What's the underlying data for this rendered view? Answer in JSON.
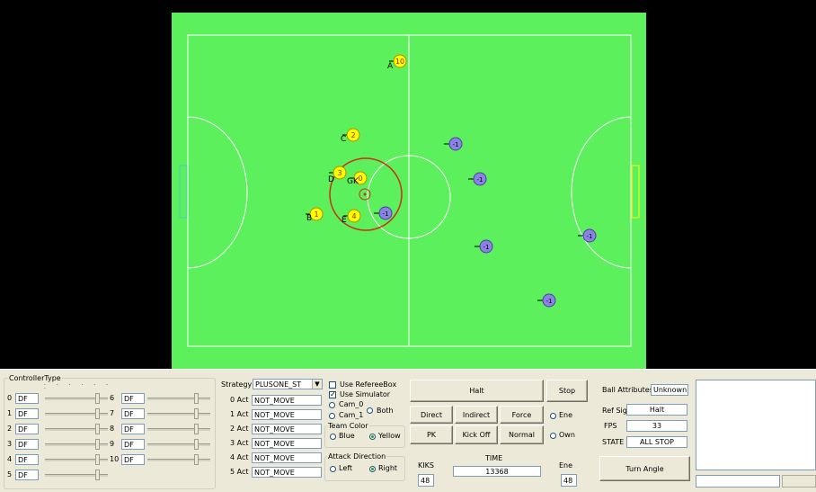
{
  "field": {
    "colors": {
      "grass": "#5cf05c",
      "lines": "#ffffff",
      "yellow": "#ffff00",
      "blue": "#8c82e6",
      "orange_ring": "#c83214"
    },
    "yellow_robots": [
      {
        "id": "0",
        "label": "GK"
      },
      {
        "id": "1",
        "label": "B"
      },
      {
        "id": "2",
        "label": "C"
      },
      {
        "id": "3",
        "label": "D"
      },
      {
        "id": "4",
        "label": "E"
      },
      {
        "id": "10",
        "label": "A"
      }
    ],
    "blue_robots": [
      {
        "id": "-1"
      },
      {
        "id": "-1"
      },
      {
        "id": "-1"
      },
      {
        "id": "-1"
      },
      {
        "id": "-1"
      },
      {
        "id": "-1"
      }
    ]
  },
  "controller": {
    "title": "ControllerType",
    "rows": [
      {
        "index": "0",
        "value": "DF"
      },
      {
        "index": "1",
        "value": "DF"
      },
      {
        "index": "2",
        "value": "DF"
      },
      {
        "index": "3",
        "value": "DF"
      },
      {
        "index": "4",
        "value": "DF"
      },
      {
        "index": "5",
        "value": "DF"
      },
      {
        "index": "6",
        "value": "DF"
      },
      {
        "index": "7",
        "value": "DF"
      },
      {
        "index": "8",
        "value": "DF"
      },
      {
        "index": "9",
        "value": "DF"
      },
      {
        "index": "10",
        "value": "DF"
      }
    ]
  },
  "strategy": {
    "label": "Strategy",
    "value": "PLUSONE_ST",
    "acts": [
      {
        "label": "0 Act",
        "value": "NOT_MOVE"
      },
      {
        "label": "1 Act",
        "value": "NOT_MOVE"
      },
      {
        "label": "2 Act",
        "value": "NOT_MOVE"
      },
      {
        "label": "3 Act",
        "value": "NOT_MOVE"
      },
      {
        "label": "4 Act",
        "value": "NOT_MOVE"
      },
      {
        "label": "5 Act",
        "value": "NOT_MOVE"
      }
    ]
  },
  "options": {
    "use_referee_box": "Use RefereeBox",
    "use_simulator": "Use Simulator",
    "cam0": "Cam_0",
    "cam1": "Cam_1",
    "both": "Both",
    "team_color": {
      "title": "Team Color",
      "blue": "Blue",
      "yellow": "Yellow"
    },
    "attack_direction": {
      "title": "Attack Direction",
      "left": "Left",
      "right": "Right"
    }
  },
  "referee": {
    "halt": "Halt",
    "stop": "Stop",
    "direct": "Direct",
    "indirect": "Indirect",
    "force": "Force",
    "pk": "PK",
    "kickoff": "Kick Off",
    "normal": "Normal",
    "ene": "Ene",
    "own": "Own",
    "kiks_label": "KIKS",
    "kiks_value": "48",
    "time_label": "TIME",
    "time_value": "13368",
    "ene_label": "Ene",
    "ene_value": "48"
  },
  "status": {
    "ball_attributes_label": "Ball Attributes",
    "ball_attributes_value": "Unknown",
    "ref_sig_label": "Ref Sig",
    "ref_sig_value": "Halt",
    "fps_label": "FPS",
    "fps_value": "33",
    "state_label": "STATE",
    "state_value": "ALL STOP",
    "turn_angle": "Turn Angle"
  }
}
